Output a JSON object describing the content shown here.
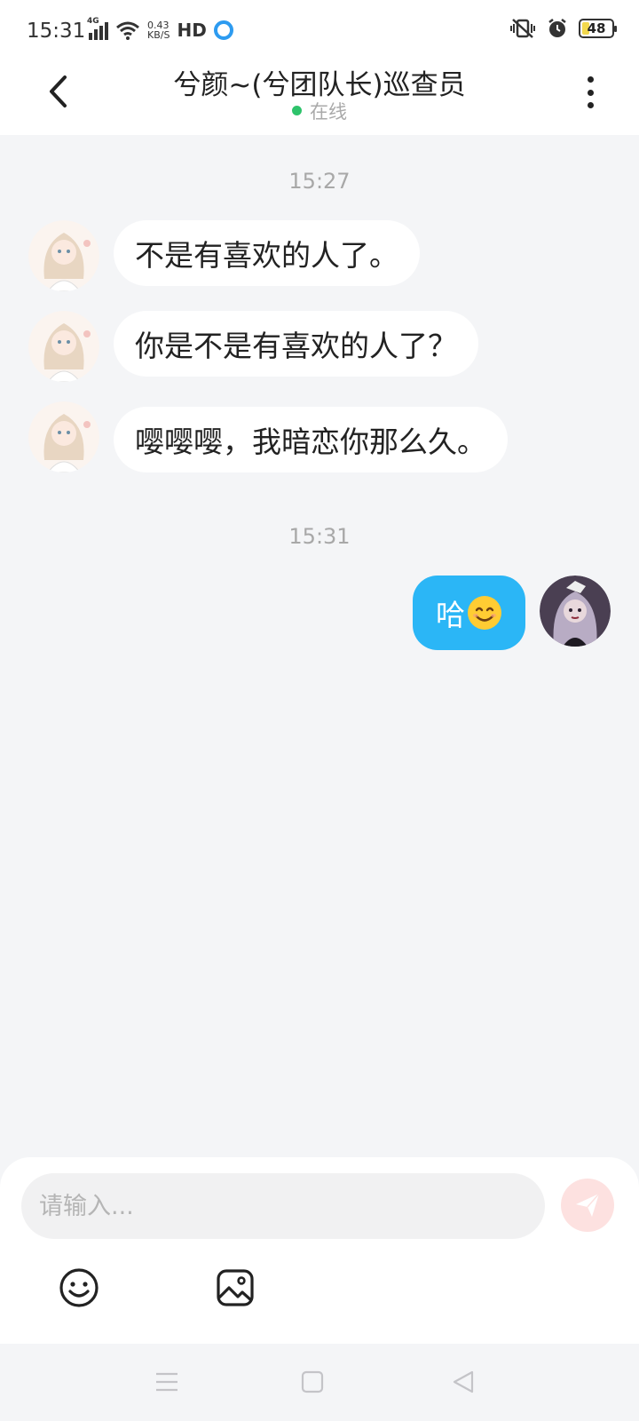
{
  "status_bar": {
    "time": "15:31",
    "net_type": "4G",
    "net_speed_value": "0.43",
    "net_speed_unit": "KB/S",
    "hd_label": "HD",
    "battery": "48"
  },
  "header": {
    "title": "兮颜~(兮团队长)巡查员",
    "status": "在线"
  },
  "chat": {
    "timestamps": [
      "15:27",
      "15:31"
    ],
    "incoming": [
      "不是有喜欢的人了。",
      "你是不是有喜欢的人了？",
      "嘤嘤嘤，我暗恋你那么久。"
    ],
    "outgoing": [
      {
        "text": "哈",
        "emoji": "smiling-face-icon"
      }
    ]
  },
  "input": {
    "placeholder": "请输入..."
  },
  "icons": {
    "back": "chevron-left-icon",
    "more": "more-vertical-icon",
    "send": "paper-plane-icon",
    "emoji": "smiley-icon",
    "image": "image-icon",
    "nav_menu": "menu-icon",
    "nav_home": "square-icon",
    "nav_back": "triangle-back-icon"
  },
  "colors": {
    "outgoing_bubble": "#2bb6f6",
    "online_dot": "#2ec36b",
    "send_button": "#fde1e0",
    "background": "#f4f5f7"
  }
}
